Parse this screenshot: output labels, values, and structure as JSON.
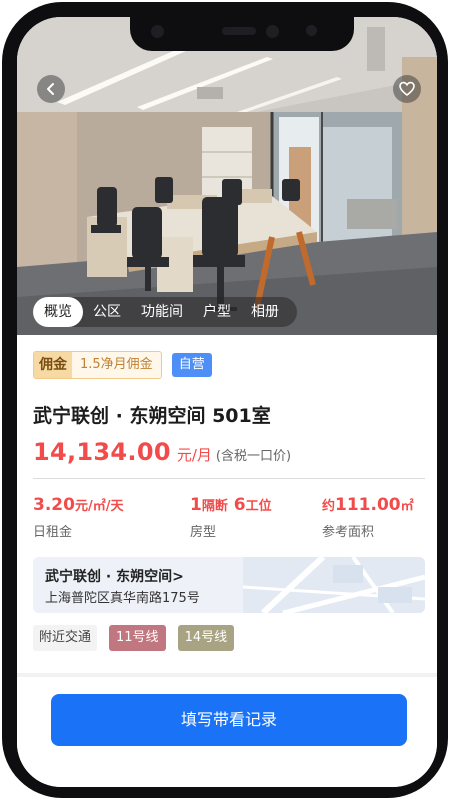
{
  "nav": {
    "back_icon": "chevron-left-icon",
    "favorite_icon": "heart-icon"
  },
  "tabs": [
    {
      "label": "概览",
      "active": true
    },
    {
      "label": "公区",
      "active": false
    },
    {
      "label": "功能间",
      "active": false
    },
    {
      "label": "户型",
      "active": false
    },
    {
      "label": "相册",
      "active": false
    }
  ],
  "listing": {
    "commission_label": "佣金",
    "commission_text": "1.5净月佣金",
    "self_operated_badge": "自营",
    "title": "武宁联创 · 东朔空间 501室",
    "price": "14,134.00",
    "price_unit": "元/月",
    "price_note": "(含税一口价)"
  },
  "stats": {
    "daily_rent": {
      "value": "3.20",
      "unit": "元/㎡/天",
      "label": "日租金"
    },
    "layout": {
      "num1": "1",
      "text1": "隔断",
      "num2": "6",
      "text2": "工位",
      "label": "房型"
    },
    "area": {
      "prefix": "约",
      "value": "111.00",
      "unit": "㎡",
      "label": "参考面积"
    }
  },
  "address": {
    "name": "武宁联创 · 东朔空间",
    "chevron": ">",
    "line": "上海普陀区真华南路175号"
  },
  "transit": {
    "label": "附近交通",
    "lines": [
      {
        "name": "11号线",
        "color": "#c07780"
      },
      {
        "name": "14号线",
        "color": "#a8a382"
      }
    ]
  },
  "action": {
    "primary_label": "填写带看记录"
  },
  "colors": {
    "accent_red": "#f24b4b",
    "primary_blue": "#1a73f6",
    "badge_blue": "#4e8ff7"
  }
}
